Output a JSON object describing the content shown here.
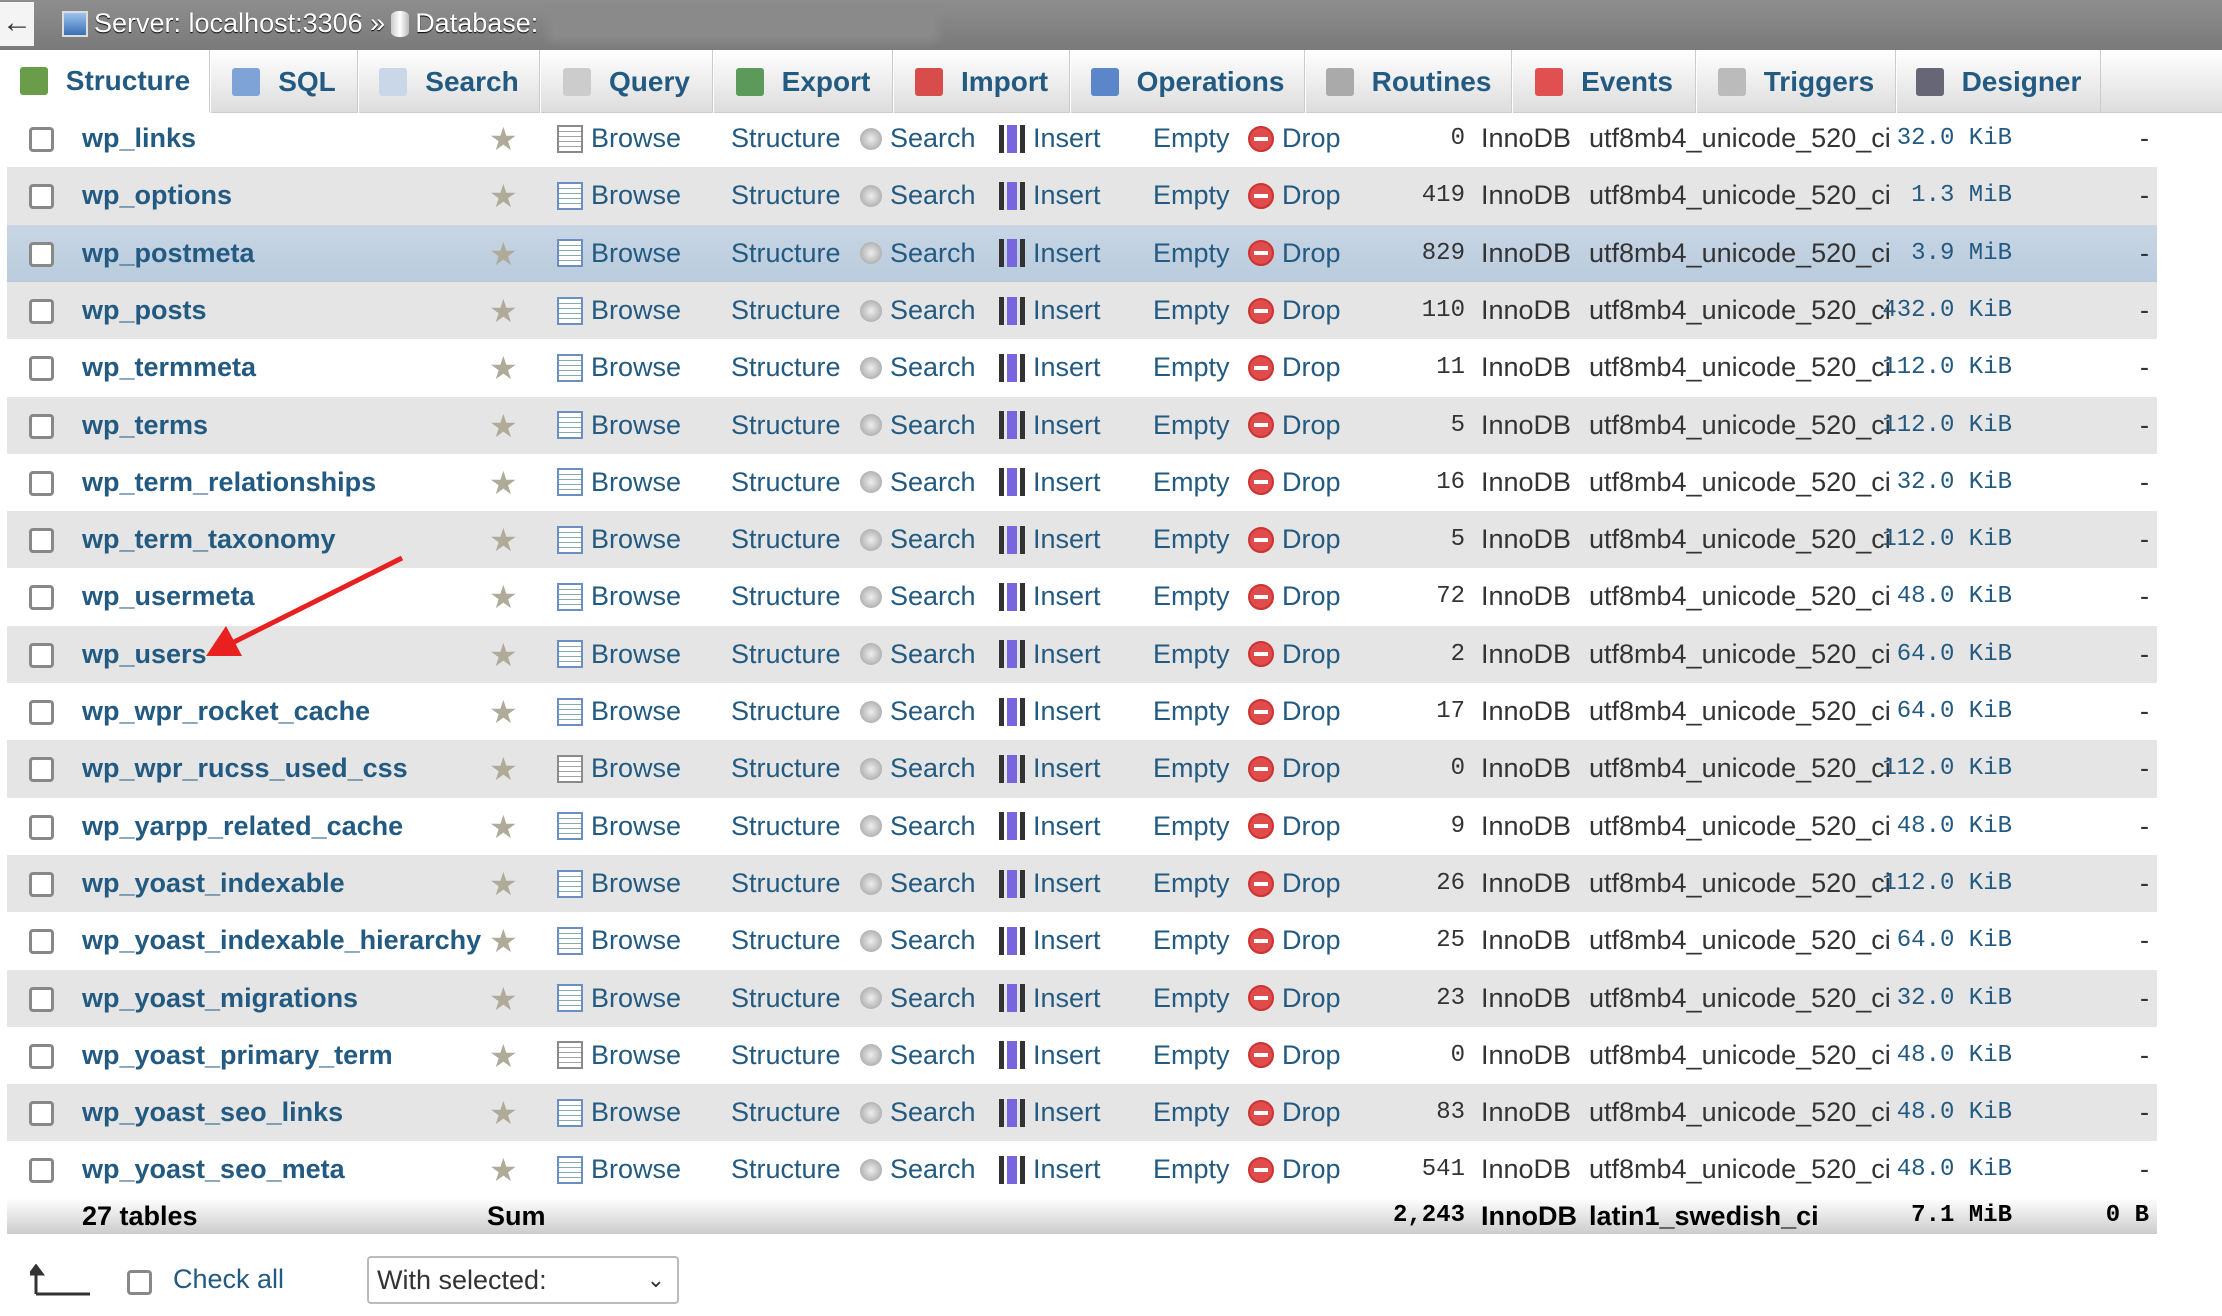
{
  "titlebar": {
    "back": "←",
    "server": "Server: localhost:3306 »",
    "database": "Database:"
  },
  "tabs": [
    {
      "label": "Structure",
      "icon": "structure-icon",
      "active": true
    },
    {
      "label": "SQL",
      "icon": "sql-icon"
    },
    {
      "label": "Search",
      "icon": "search-icon"
    },
    {
      "label": "Query",
      "icon": "query-icon"
    },
    {
      "label": "Export",
      "icon": "export-icon"
    },
    {
      "label": "Import",
      "icon": "import-icon"
    },
    {
      "label": "Operations",
      "icon": "wrench-icon"
    },
    {
      "label": "Routines",
      "icon": "routines-icon"
    },
    {
      "label": "Events",
      "icon": "clock-icon"
    },
    {
      "label": "Triggers",
      "icon": "triggers-icon"
    },
    {
      "label": "Designer",
      "icon": "designer-icon"
    }
  ],
  "actions": {
    "browse": "Browse",
    "structure": "Structure",
    "search": "Search",
    "insert": "Insert",
    "empty": "Empty",
    "drop": "Drop"
  },
  "tables": [
    {
      "name": "wp_links",
      "rows": "0",
      "engine": "InnoDB",
      "collation": "utf8mb4_unicode_520_ci",
      "size": "32.0 KiB",
      "overhead": "-"
    },
    {
      "name": "wp_options",
      "rows": "419",
      "engine": "InnoDB",
      "collation": "utf8mb4_unicode_520_ci",
      "size": "1.3 MiB",
      "overhead": "-"
    },
    {
      "name": "wp_postmeta",
      "rows": "829",
      "engine": "InnoDB",
      "collation": "utf8mb4_unicode_520_ci",
      "size": "3.9 MiB",
      "overhead": "-",
      "highlighted": true
    },
    {
      "name": "wp_posts",
      "rows": "110",
      "engine": "InnoDB",
      "collation": "utf8mb4_unicode_520_ci",
      "size": "432.0 KiB",
      "overhead": "-"
    },
    {
      "name": "wp_termmeta",
      "rows": "11",
      "engine": "InnoDB",
      "collation": "utf8mb4_unicode_520_ci",
      "size": "112.0 KiB",
      "overhead": "-"
    },
    {
      "name": "wp_terms",
      "rows": "5",
      "engine": "InnoDB",
      "collation": "utf8mb4_unicode_520_ci",
      "size": "112.0 KiB",
      "overhead": "-"
    },
    {
      "name": "wp_term_relationships",
      "rows": "16",
      "engine": "InnoDB",
      "collation": "utf8mb4_unicode_520_ci",
      "size": "32.0 KiB",
      "overhead": "-"
    },
    {
      "name": "wp_term_taxonomy",
      "rows": "5",
      "engine": "InnoDB",
      "collation": "utf8mb4_unicode_520_ci",
      "size": "112.0 KiB",
      "overhead": "-"
    },
    {
      "name": "wp_usermeta",
      "rows": "72",
      "engine": "InnoDB",
      "collation": "utf8mb4_unicode_520_ci",
      "size": "48.0 KiB",
      "overhead": "-"
    },
    {
      "name": "wp_users",
      "rows": "2",
      "engine": "InnoDB",
      "collation": "utf8mb4_unicode_520_ci",
      "size": "64.0 KiB",
      "overhead": "-"
    },
    {
      "name": "wp_wpr_rocket_cache",
      "rows": "17",
      "engine": "InnoDB",
      "collation": "utf8mb4_unicode_520_ci",
      "size": "64.0 KiB",
      "overhead": "-"
    },
    {
      "name": "wp_wpr_rucss_used_css",
      "rows": "0",
      "engine": "InnoDB",
      "collation": "utf8mb4_unicode_520_ci",
      "size": "112.0 KiB",
      "overhead": "-"
    },
    {
      "name": "wp_yarpp_related_cache",
      "rows": "9",
      "engine": "InnoDB",
      "collation": "utf8mb4_unicode_520_ci",
      "size": "48.0 KiB",
      "overhead": "-"
    },
    {
      "name": "wp_yoast_indexable",
      "rows": "26",
      "engine": "InnoDB",
      "collation": "utf8mb4_unicode_520_ci",
      "size": "112.0 KiB",
      "overhead": "-"
    },
    {
      "name": "wp_yoast_indexable_hierarchy",
      "rows": "25",
      "engine": "InnoDB",
      "collation": "utf8mb4_unicode_520_ci",
      "size": "64.0 KiB",
      "overhead": "-"
    },
    {
      "name": "wp_yoast_migrations",
      "rows": "23",
      "engine": "InnoDB",
      "collation": "utf8mb4_unicode_520_ci",
      "size": "32.0 KiB",
      "overhead": "-"
    },
    {
      "name": "wp_yoast_primary_term",
      "rows": "0",
      "engine": "InnoDB",
      "collation": "utf8mb4_unicode_520_ci",
      "size": "48.0 KiB",
      "overhead": "-"
    },
    {
      "name": "wp_yoast_seo_links",
      "rows": "83",
      "engine": "InnoDB",
      "collation": "utf8mb4_unicode_520_ci",
      "size": "48.0 KiB",
      "overhead": "-"
    },
    {
      "name": "wp_yoast_seo_meta",
      "rows": "541",
      "engine": "InnoDB",
      "collation": "utf8mb4_unicode_520_ci",
      "size": "48.0 KiB",
      "overhead": "-"
    }
  ],
  "footer": {
    "count": "27 tables",
    "sum": "Sum",
    "rows": "2,243",
    "engine": "InnoDB",
    "collation": "latin1_swedish_ci",
    "size": "7.1 MiB",
    "overhead": "0 B"
  },
  "bottom": {
    "check_all": "Check all",
    "with_selected": "With selected:"
  },
  "colors": {
    "link": "#235a81",
    "highlight": "#c8d6e4",
    "stripe": "#e5e5e5",
    "annotation_arrow": "#e8201f"
  }
}
